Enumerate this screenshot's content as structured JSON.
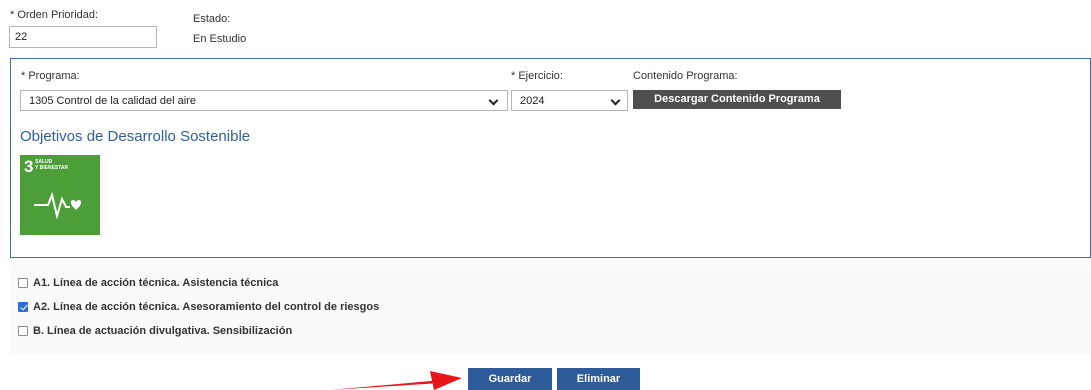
{
  "header": {
    "orden_label": "* Orden Prioridad:",
    "orden_value": "22",
    "estado_label": "Estado:",
    "estado_value": "En Estudio"
  },
  "programa": {
    "label": "* Programa:",
    "selected": "1305 Control de la calidad del aire"
  },
  "ejercicio": {
    "label": "* Ejercicio:",
    "selected": "2024"
  },
  "contenido": {
    "label": "Contenido Programa:",
    "button_label": "Descargar Contenido Programa"
  },
  "ods": {
    "title": "Objetivos de Desarrollo Sostenible",
    "tile_number": "3",
    "tile_text_line1": "SALUD",
    "tile_text_line2": "Y BIENESTAR",
    "tile_color": "#4c9f38"
  },
  "lineas": [
    {
      "label": "A1. Línea de acción técnica. Asistencia técnica",
      "checked": false
    },
    {
      "label": "A2. Línea de acción técnica. Asesoramiento del control de riesgos",
      "checked": true
    },
    {
      "label": "B. Línea de actuación divulgativa. Sensibilización",
      "checked": false
    }
  ],
  "actions": {
    "guardar": "Guardar",
    "eliminar": "Eliminar"
  },
  "colors": {
    "panel_border": "#3a6fb4",
    "primary_button": "#2e5c9a",
    "secondary_button": "#4f4f4f",
    "arrow": "#e8161b"
  }
}
